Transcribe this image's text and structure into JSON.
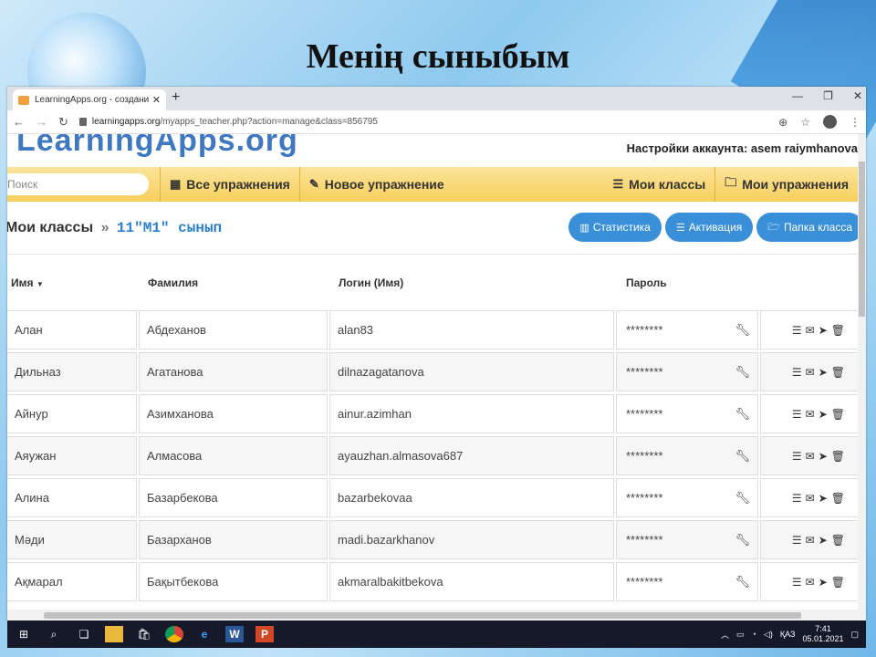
{
  "slide": {
    "title": "Менің сыныбым"
  },
  "browser": {
    "tab_title": "LearningApps.org - создание му",
    "tab_close": "✕",
    "new_tab": "+",
    "url_domain": "learningapps.org",
    "url_path": "/myapps_teacher.php?action=manage&class=856795"
  },
  "site": {
    "logo": "LearningApps.org",
    "account_label": "Настройки аккаунта: asem raiymhanova",
    "search_placeholder": "Поиск",
    "menu": [
      "Все упражнения",
      "Новое упражнение",
      "Мои классы",
      "Мои упражнения"
    ],
    "breadcrumb_root": "Мои классы",
    "breadcrumb_sep": "»",
    "breadcrumb_class": "11\"М1\" сынып",
    "buttons": {
      "stats": "Статистика",
      "activation": "Активация",
      "folder": "Папка класса"
    },
    "columns": {
      "first": "Имя",
      "last": "Фамилия",
      "login": "Логин (Имя)",
      "password": "Пароль",
      "sort_arrow": "▼"
    },
    "rows": [
      {
        "first": "Алан",
        "last": "Абдеханов",
        "login": "alan83",
        "password": "********"
      },
      {
        "first": "Дильназ",
        "last": "Агатанова",
        "login": "dilnazagatanova",
        "password": "********"
      },
      {
        "first": "Айнур",
        "last": "Азимханова",
        "login": "ainur.azimhan",
        "password": "********"
      },
      {
        "first": "Аяужан",
        "last": "Алмасова",
        "login": "ayauzhan.almasova687",
        "password": "********"
      },
      {
        "first": "Алина",
        "last": "Базарбекова",
        "login": "bazarbekovaa",
        "password": "********"
      },
      {
        "first": "Мәди",
        "last": "Базарханов",
        "login": "madi.bazarkhanov",
        "password": "********"
      },
      {
        "first": "Ақмарал",
        "last": "Бақытбекова",
        "login": "akmaralbakitbekova",
        "password": "********"
      }
    ]
  },
  "taskbar": {
    "lang": "ҚАЗ",
    "time": "7:41",
    "date": "05.01.2021"
  }
}
